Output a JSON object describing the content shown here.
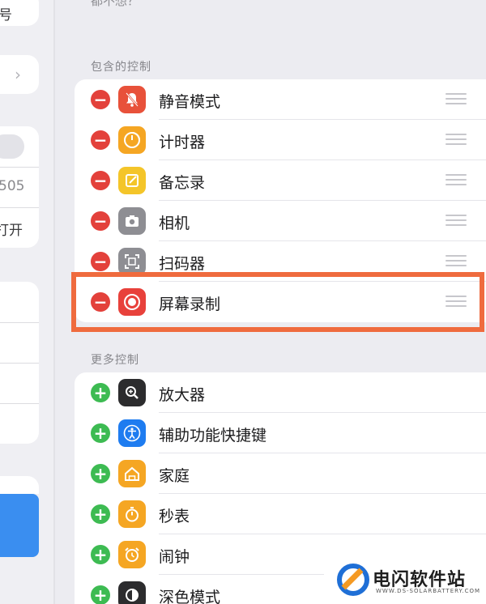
{
  "left_pane": {
    "frag_1": "号",
    "frag_2": "505",
    "frag_3": "打开"
  },
  "top_cut": "都不想？",
  "included": {
    "header": "包含的控制",
    "items": [
      {
        "label": "静音模式",
        "icon": "bell-slash-icon",
        "color": "#e8513a"
      },
      {
        "label": "计时器",
        "icon": "timer-icon",
        "color": "#f5a623"
      },
      {
        "label": "备忘录",
        "icon": "notes-icon",
        "color": "#f4c529"
      },
      {
        "label": "相机",
        "icon": "camera-icon",
        "color": "#8e8e93"
      },
      {
        "label": "扫码器",
        "icon": "qr-scanner-icon",
        "color": "#8e8e93"
      },
      {
        "label": "屏幕录制",
        "icon": "screen-record-icon",
        "color": "#e8413b"
      }
    ]
  },
  "more": {
    "header": "更多控制",
    "items": [
      {
        "label": "放大器",
        "icon": "magnifier-icon",
        "color": "#2c2c2e"
      },
      {
        "label": "辅助功能快捷键",
        "icon": "accessibility-icon",
        "color": "#1e7cf0"
      },
      {
        "label": "家庭",
        "icon": "home-icon",
        "color": "#f5a623"
      },
      {
        "label": "秒表",
        "icon": "stopwatch-icon",
        "color": "#f5a623"
      },
      {
        "label": "闹钟",
        "icon": "alarm-icon",
        "color": "#f5a623"
      },
      {
        "label": "深色模式",
        "icon": "dark-mode-icon",
        "color": "#2c2c2e"
      }
    ]
  },
  "colors": {
    "remove": "#e3413b",
    "add": "#3dbb52",
    "highlight": "#ef6b3e",
    "accent_blue": "#3a8ef0"
  },
  "watermark": {
    "title": "电闪软件站",
    "subtitle": "WWW.DS-SOLARBATTERY.COM"
  }
}
